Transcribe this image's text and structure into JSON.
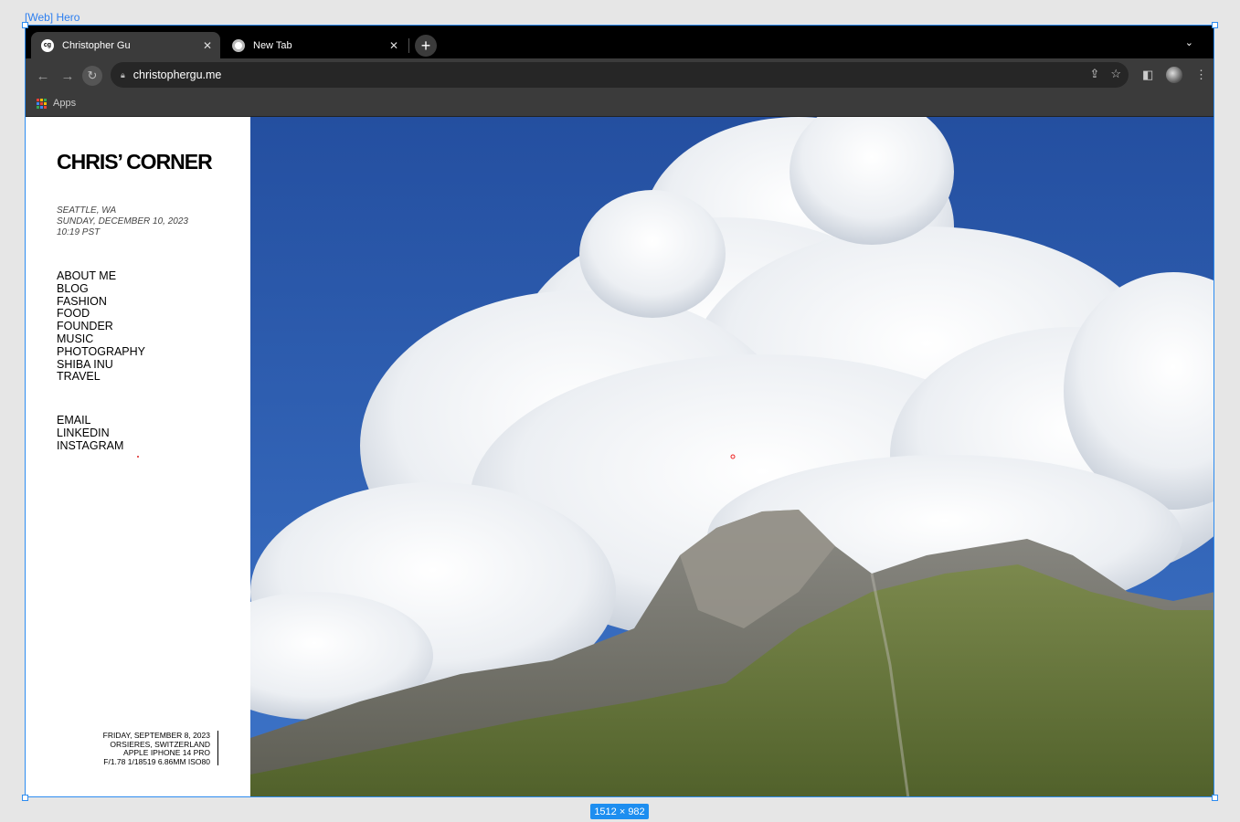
{
  "canvas": {
    "frame_label": "[Web] Hero",
    "size_badge": "1512 × 982"
  },
  "browser": {
    "tabs": [
      {
        "title": "Christopher Gu",
        "favicon": "cg",
        "active": true
      },
      {
        "title": "New Tab",
        "favicon": "chrome-icon",
        "active": false
      }
    ],
    "url": "christophergu.me",
    "bookmarks": {
      "apps_label": "Apps"
    }
  },
  "site": {
    "brand": "CHRIS’ CORNER",
    "location": "SEATTLE, WA",
    "date": "SUNDAY, DECEMBER 10, 2023",
    "time": "10:19 PST",
    "nav": [
      "ABOUT ME",
      "BLOG",
      "FASHION",
      "FOOD",
      "FOUNDER",
      "MUSIC",
      "PHOTOGRAPHY",
      "SHIBA INU",
      "TRAVEL"
    ],
    "social": [
      "EMAIL",
      "LINKEDIN",
      "INSTAGRAM"
    ],
    "photo_caption": {
      "date": "FRIDAY, SEPTEMBER 8, 2023",
      "place": "ORSIERES, SWITZERLAND",
      "camera": "APPLE IPHONE 14 PRO",
      "settings": "F/1.78 1/18519 6.86MM ISO80"
    }
  },
  "colors": {
    "sky": "#2f5fb0",
    "tabbar": "#000000",
    "toolbar": "#3b3b3b",
    "selection": "#2d8cf0"
  }
}
